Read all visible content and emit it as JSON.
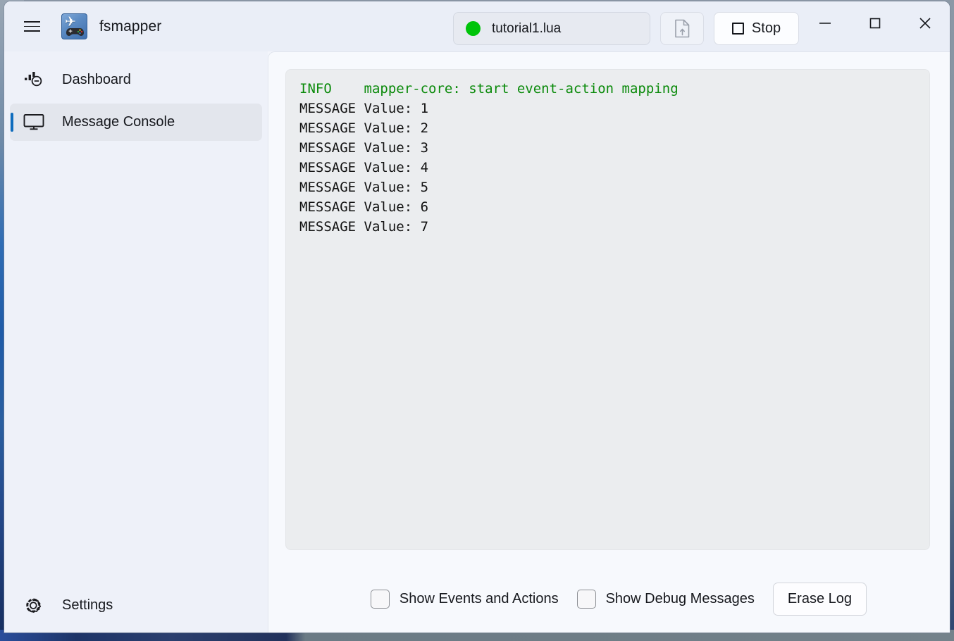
{
  "app": {
    "title": "fsmapper",
    "icon": "app-plane-gamepad-icon",
    "menu_icon": "hamburger-menu-icon"
  },
  "titlebar": {
    "script": {
      "status_color": "#00c40a",
      "name": "tutorial1.lua"
    },
    "open_button_icon": "open-file-icon",
    "stop_button_label": "Stop",
    "stop_button_icon": "stop-square-icon",
    "minimize_icon": "minimize-icon",
    "maximize_icon": "maximize-icon",
    "close_icon": "close-icon"
  },
  "sidebar": {
    "items": [
      {
        "label": "Dashboard",
        "icon": "gauge-icon",
        "selected": false
      },
      {
        "label": "Message Console",
        "icon": "monitor-icon",
        "selected": true
      }
    ],
    "footer": {
      "label": "Settings",
      "icon": "gear-icon"
    },
    "accent_color": "#0f6cbd"
  },
  "console": {
    "lines": [
      {
        "level": "INFO",
        "text": "INFO    mapper-core: start event-action mapping",
        "color": "#0a8a0a"
      },
      {
        "level": "MESSAGE",
        "text": "MESSAGE Value: 1",
        "color": "#121212"
      },
      {
        "level": "MESSAGE",
        "text": "MESSAGE Value: 2",
        "color": "#121212"
      },
      {
        "level": "MESSAGE",
        "text": "MESSAGE Value: 3",
        "color": "#121212"
      },
      {
        "level": "MESSAGE",
        "text": "MESSAGE Value: 4",
        "color": "#121212"
      },
      {
        "level": "MESSAGE",
        "text": "MESSAGE Value: 5",
        "color": "#121212"
      },
      {
        "level": "MESSAGE",
        "text": "MESSAGE Value: 6",
        "color": "#121212"
      },
      {
        "level": "MESSAGE",
        "text": "MESSAGE Value: 7",
        "color": "#121212"
      }
    ]
  },
  "footer": {
    "show_events_label": "Show Events and Actions",
    "show_events_checked": false,
    "show_debug_label": "Show Debug Messages",
    "show_debug_checked": false,
    "erase_log_label": "Erase Log"
  }
}
